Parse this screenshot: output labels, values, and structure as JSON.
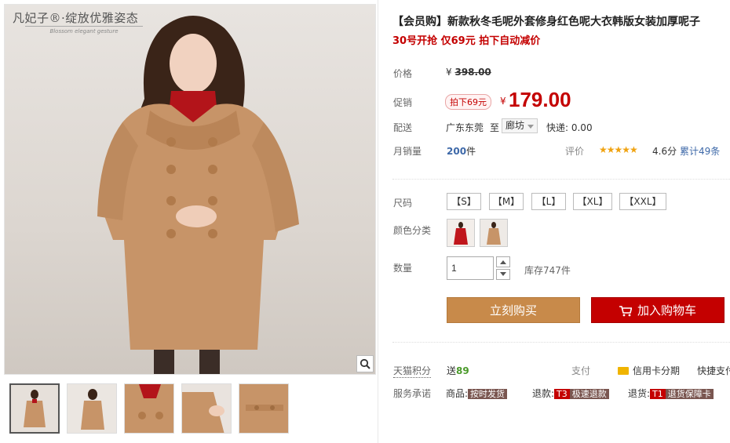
{
  "gallery": {
    "brand": "凡妃子®·绽放优雅姿态",
    "brand_sub": "Blossom elegant gesture",
    "zoom_icon": "magnifier-icon",
    "thumbnails": [
      "thumb-1",
      "thumb-2",
      "thumb-3",
      "thumb-4",
      "thumb-5"
    ]
  },
  "product": {
    "title": "【会员购】新款秋冬毛呢外套修身红色呢大衣韩版女装加厚呢子",
    "subtitle": "30号开抢 仅69元 拍下自动减价"
  },
  "price": {
    "label": "价格",
    "currency": "¥",
    "original": "398.00"
  },
  "promo": {
    "label": "促销",
    "tag": "拍下69元",
    "currency": "¥",
    "price": "179.00"
  },
  "shipping": {
    "label": "配送",
    "from": "广东东莞",
    "to_label": "至",
    "to": "廊坊",
    "express": "快递: 0.00"
  },
  "sales": {
    "label": "月销量",
    "count": "200",
    "unit": "件",
    "rating_label": "评价",
    "stars": "★★★★★",
    "score": "4.6分",
    "reviews": "累计49条"
  },
  "size": {
    "label": "尺码",
    "options": [
      "【S】",
      "【M】",
      "【L】",
      "【XL】",
      "【XXL】"
    ]
  },
  "color": {
    "label": "颜色分类",
    "swatches": [
      "red",
      "camel"
    ]
  },
  "quantity": {
    "label": "数量",
    "value": "1",
    "stock": "库存747件"
  },
  "actions": {
    "buy_now": "立刻购买",
    "add_to_cart": "加入购物车"
  },
  "points": {
    "label": "天猫积分",
    "prefix": "送",
    "value": "89",
    "pay_label": "支付",
    "card_installment": "信用卡分期",
    "fast_pay": "快捷支付"
  },
  "service": {
    "label": "服务承诺",
    "goods_prefix": "商品:",
    "goods_badge": "按时发货",
    "refund_prefix": "退款:",
    "refund_code": "T3",
    "refund_badge": "极速退款",
    "return_prefix": "退货:",
    "return_code": "T1",
    "return_badge": "退货保障卡"
  },
  "colors": {
    "price_red": "#c40000",
    "buy_button": "#c88a4a",
    "cart_button": "#c40000",
    "link_blue": "#3d68a8",
    "star_gold": "#f0a312"
  }
}
